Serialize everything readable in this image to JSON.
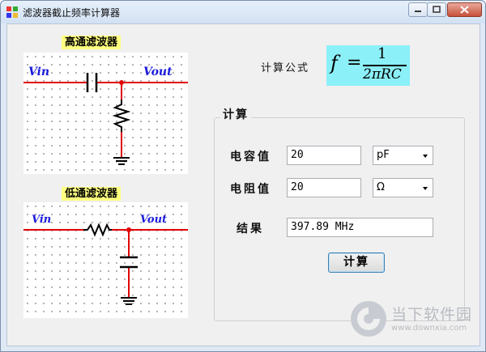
{
  "window": {
    "title": "滤波器截止频率计算器"
  },
  "high_pass": {
    "title": "高通滤波器",
    "vin": "Vin",
    "vout": "Vout"
  },
  "low_pass": {
    "title": "低通滤波器",
    "vin": "Vin",
    "vout": "Vout"
  },
  "formula": {
    "label": "计算公式",
    "lhs": "f",
    "equals": "=",
    "numerator": "1",
    "denominator": "2πRC"
  },
  "calc_group": {
    "title": "计算",
    "capacitance": {
      "label": "电容值",
      "value": "20",
      "unit": "pF"
    },
    "resistance": {
      "label": "电阻值",
      "value": "20",
      "unit": "Ω"
    },
    "result": {
      "label": "结果",
      "value": "397.89 MHz"
    },
    "button_label": "计算"
  },
  "watermark": {
    "text": "当下软件园",
    "url": "www.downxia.com"
  },
  "colors": {
    "wire": "#e00000",
    "label_blue": "#1a1adc",
    "title_highlight": "#ffff80",
    "formula_bg": "#8cf0f8"
  }
}
